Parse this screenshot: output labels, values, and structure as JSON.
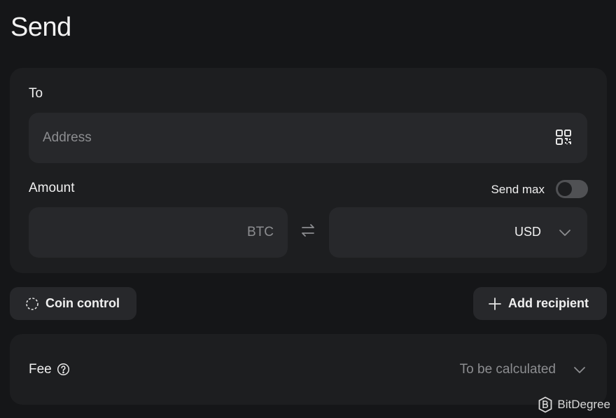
{
  "page": {
    "title": "Send"
  },
  "recipient": {
    "label": "To",
    "address_placeholder": "Address",
    "qr_icon": "qr-code-icon"
  },
  "amount": {
    "label": "Amount",
    "send_max_label": "Send max",
    "send_max_on": false,
    "crypto_unit": "BTC",
    "fiat_unit": "USD",
    "swap_icon": "swap-arrows-icon"
  },
  "actions": {
    "coin_control_label": "Coin control",
    "add_recipient_label": "Add recipient"
  },
  "fee": {
    "label": "Fee",
    "status": "To be calculated"
  },
  "watermark": {
    "text": "BitDegree"
  },
  "colors": {
    "background": "#151618",
    "card": "#1d1e20",
    "field": "#27282b",
    "muted_text": "#8c8d90",
    "toggle_off": "#505154"
  }
}
